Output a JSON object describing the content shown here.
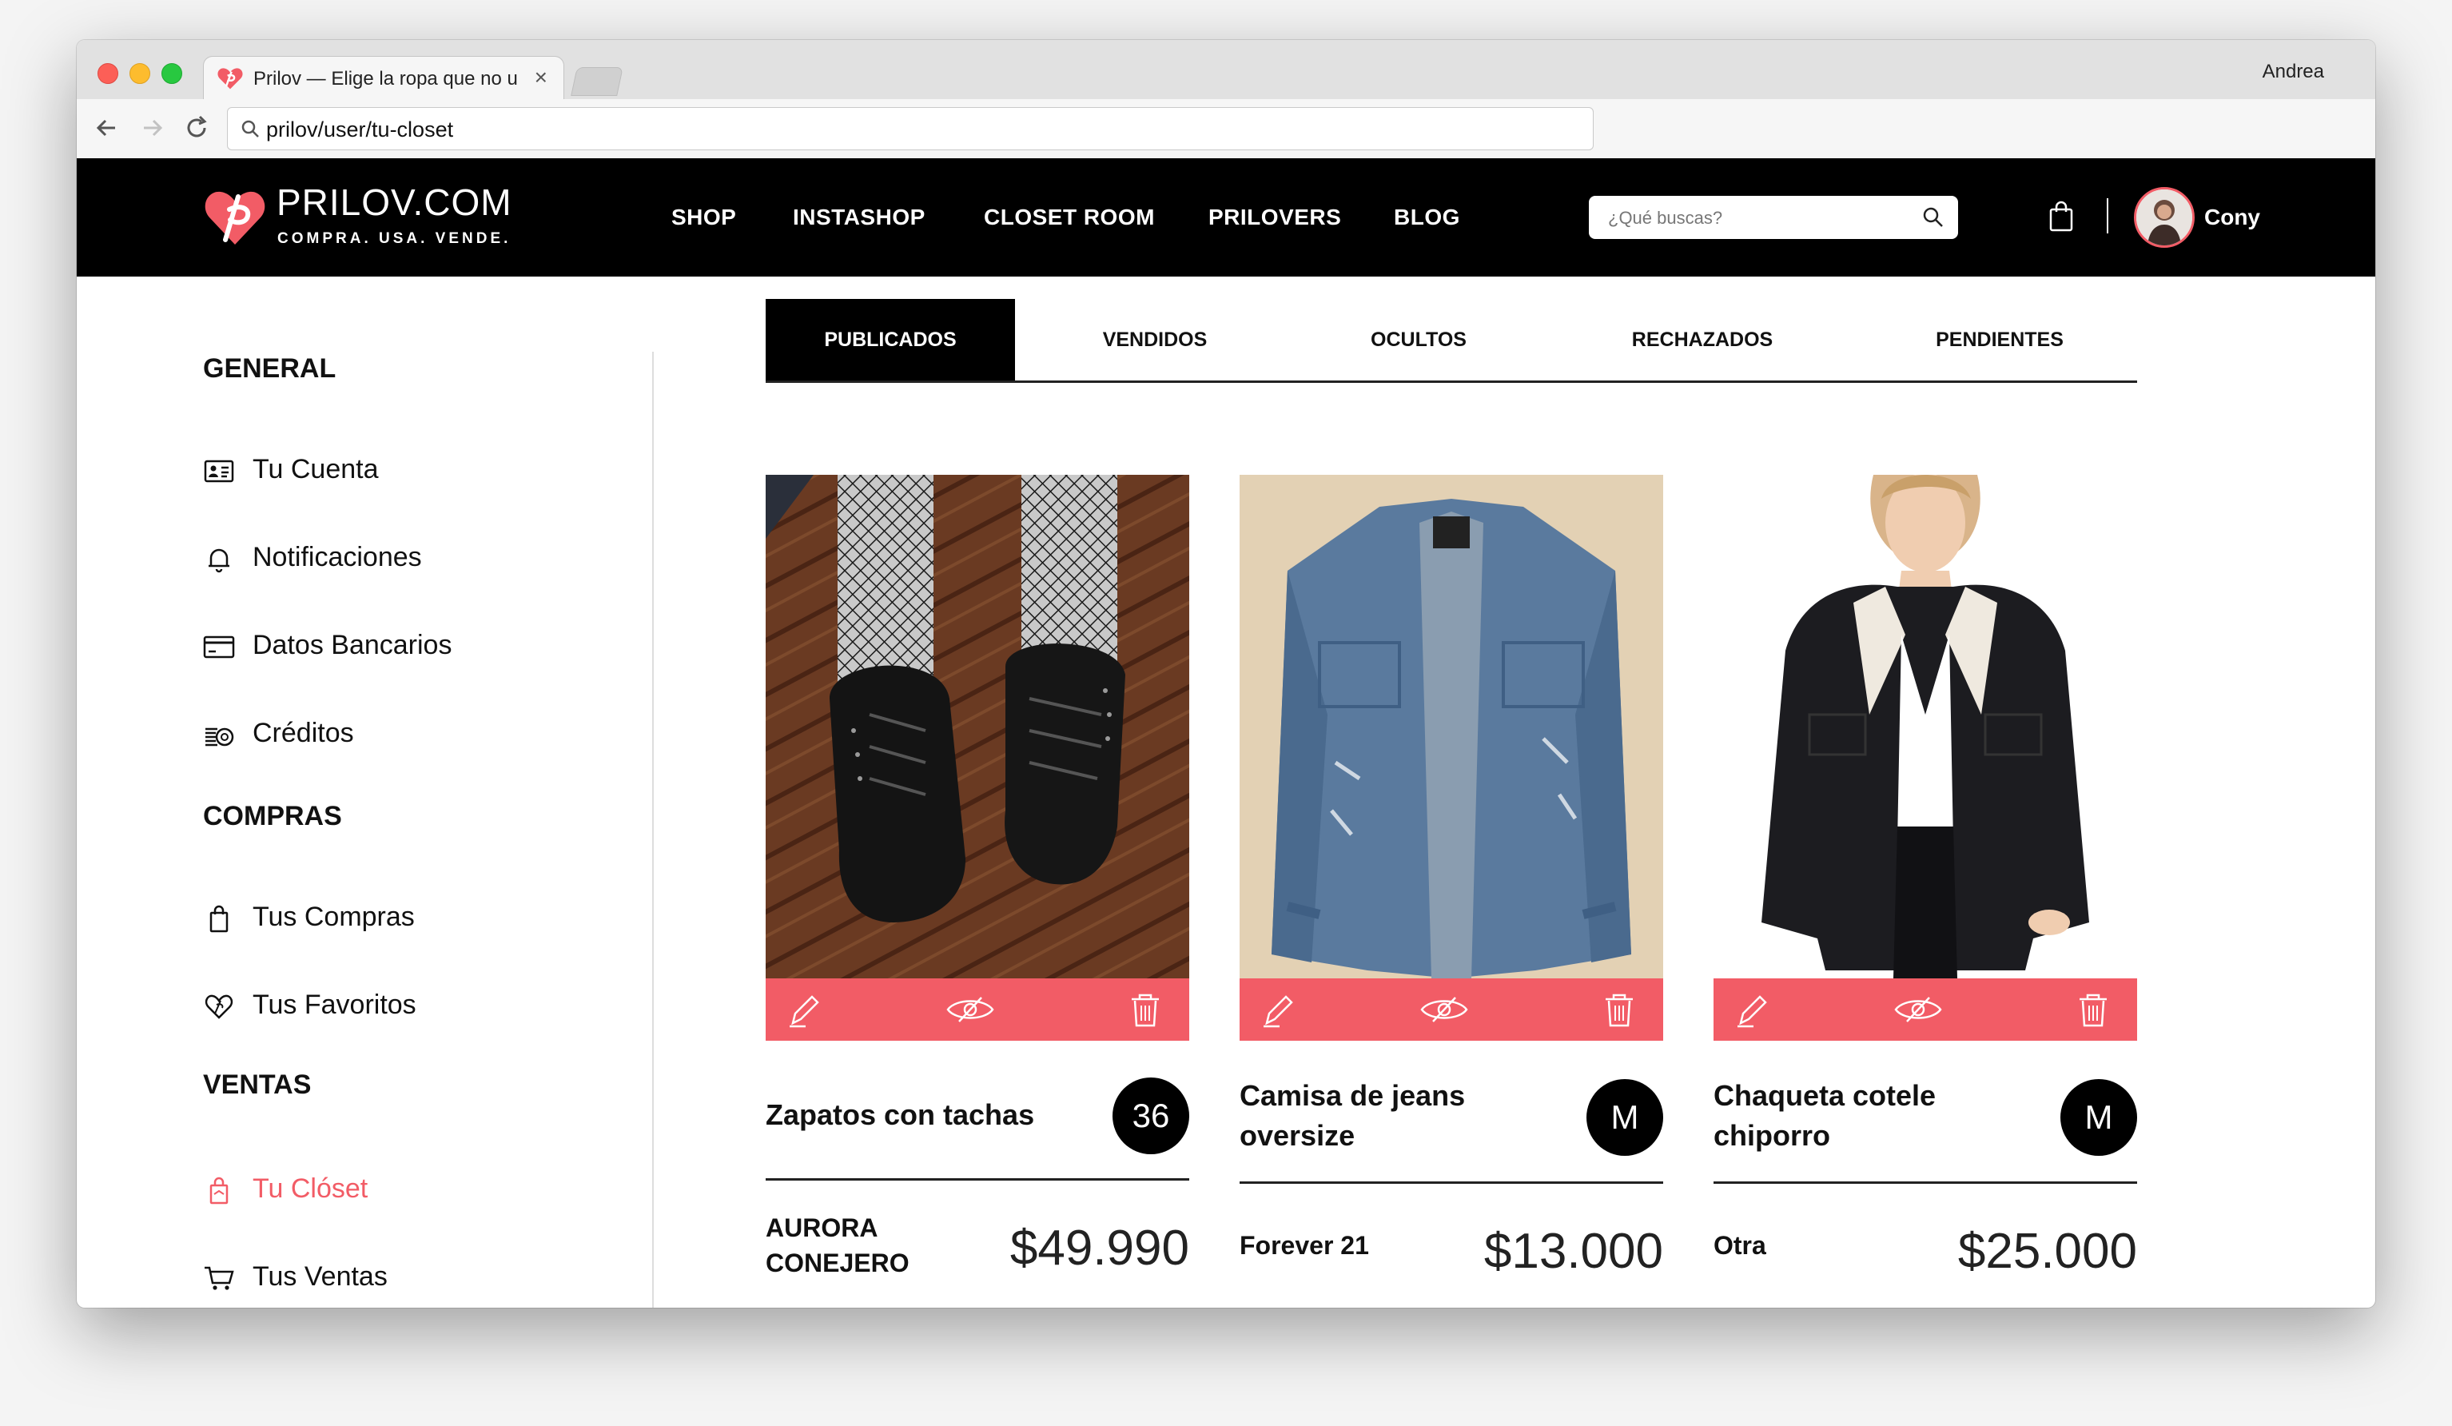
{
  "browser": {
    "tab_title": "Prilov — Elige la ropa que no u",
    "tab_close": "×",
    "profile_name": "Andrea",
    "url": "prilov/user/tu-closet"
  },
  "header": {
    "logo_name": "PRILOV.COM",
    "logo_tagline": "COMPRA. USA. VENDE.",
    "nav": [
      "SHOP",
      "INSTASHOP",
      "CLOSET ROOM",
      "PRILOVERS",
      "BLOG"
    ],
    "search_placeholder": "¿Qué buscas?",
    "user_name": "Cony",
    "brand_color": "#f25c66"
  },
  "sidebar": {
    "sections": [
      {
        "title": "GENERAL",
        "items": [
          {
            "label": "Tu Cuenta",
            "icon": "id-card-icon"
          },
          {
            "label": "Notificaciones",
            "icon": "bell-icon"
          },
          {
            "label": "Datos Bancarios",
            "icon": "credit-card-icon"
          },
          {
            "label": "Créditos",
            "icon": "coins-icon"
          }
        ]
      },
      {
        "title": "COMPRAS",
        "items": [
          {
            "label": "Tus Compras",
            "icon": "shopping-bag-icon"
          },
          {
            "label": "Tus Favoritos",
            "icon": "heart-icon"
          }
        ]
      },
      {
        "title": "VENTAS",
        "items": [
          {
            "label": "Tu Clóset",
            "icon": "hanger-bag-icon",
            "active": true
          },
          {
            "label": "Tus Ventas",
            "icon": "cart-icon"
          }
        ]
      }
    ]
  },
  "closet_tabs": [
    "PUBLICADOS",
    "VENDIDOS",
    "OCULTOS",
    "RECHAZADOS",
    "PENDIENTES"
  ],
  "active_tab": "PUBLICADOS",
  "products": [
    {
      "title": "Zapatos con tachas",
      "size": "36",
      "brand": "AURORA CONEJERO",
      "price": "$49.990",
      "image": "black lace-up studded boots on wood floor"
    },
    {
      "title": "Camisa de jeans oversize",
      "size": "M",
      "brand": "Forever 21",
      "price": "$13.000",
      "image": "denim shirt on hanger"
    },
    {
      "title": "Chaqueta cotele chiporro",
      "size": "M",
      "brand": "Otra",
      "price": "$25.000",
      "image": "black corduroy jacket with sherpa collar"
    }
  ]
}
